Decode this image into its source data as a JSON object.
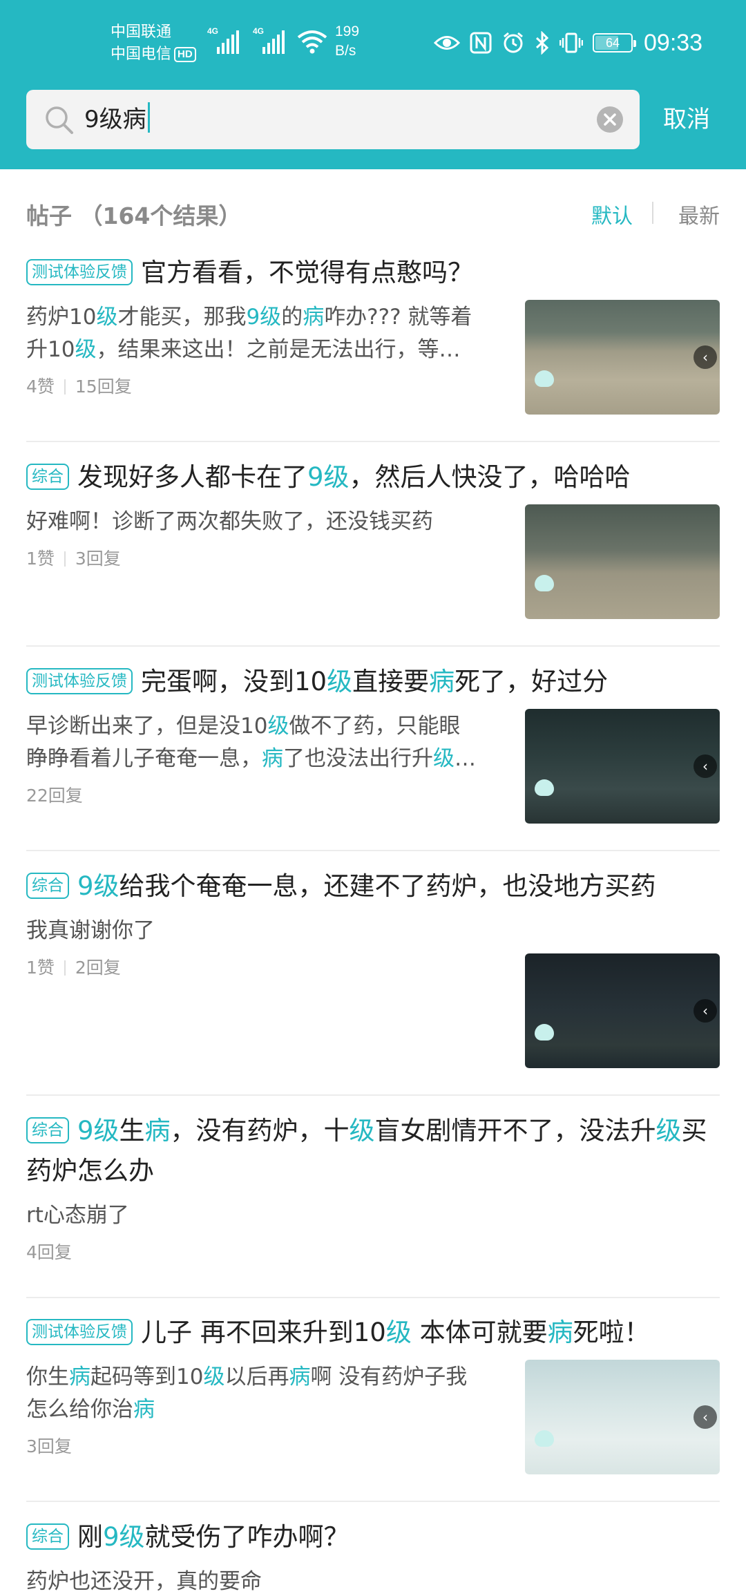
{
  "status_bar": {
    "carrier_1": "中国联通",
    "carrier_2": "中国电信",
    "hd_label": "HD",
    "net_1": "4G",
    "net_2": "4G",
    "speed_value": "199",
    "speed_unit": "B/s",
    "battery_level": "64",
    "time": "09:33"
  },
  "search": {
    "query": "9级病",
    "cancel_label": "取消"
  },
  "results": {
    "title": "帖子 （164个结果）",
    "sort_default": "默认",
    "sort_latest": "最新"
  },
  "posts": [
    {
      "tag": "测试体验反馈",
      "title": [
        {
          "t": "官方看看，不觉得有点憨吗？",
          "h": false
        }
      ],
      "excerpt_lines": [
        [
          {
            "t": "药炉10",
            "h": false
          },
          {
            "t": "级",
            "h": true
          },
          {
            "t": "才能买，那我",
            "h": false
          },
          {
            "t": "9级",
            "h": true
          },
          {
            "t": "的",
            "h": false
          },
          {
            "t": "病",
            "h": true
          },
          {
            "t": "咋办??? 就等着",
            "h": false
          }
        ],
        [
          {
            "t": "升10",
            "h": false
          },
          {
            "t": "级",
            "h": true
          },
          {
            "t": "，结果来这出！之前是无法出行，等…",
            "h": false
          }
        ]
      ],
      "likes": "4赞",
      "replies": "15回复"
    },
    {
      "tag": "综合",
      "title": [
        {
          "t": "发现好多人都卡在了",
          "h": false
        },
        {
          "t": "9级",
          "h": true
        },
        {
          "t": "，然后人快没了，哈哈哈",
          "h": false
        }
      ],
      "excerpt_lines": [
        [
          {
            "t": "好难啊！诊断了两次都失败了，还没钱买药",
            "h": false
          }
        ]
      ],
      "likes": "1赞",
      "replies": "3回复"
    },
    {
      "tag": "测试体验反馈",
      "title": [
        {
          "t": "完蛋啊，没到10",
          "h": false
        },
        {
          "t": "级",
          "h": true
        },
        {
          "t": "直接要",
          "h": false
        },
        {
          "t": "病",
          "h": true
        },
        {
          "t": "死了，好过分",
          "h": false
        }
      ],
      "excerpt_lines": [
        [
          {
            "t": "早诊断出来了，但是没10",
            "h": false
          },
          {
            "t": "级",
            "h": true
          },
          {
            "t": "做不了药，只能眼",
            "h": false
          }
        ],
        [
          {
            "t": "睁睁看着儿子奄奄一息，",
            "h": false
          },
          {
            "t": "病",
            "h": true
          },
          {
            "t": "了也没法出行升",
            "h": false
          },
          {
            "t": "级",
            "h": true
          },
          {
            "t": "…",
            "h": false
          }
        ]
      ],
      "likes": "",
      "replies": "22回复"
    },
    {
      "tag": "综合",
      "title": [
        {
          "t": "9级",
          "h": true
        },
        {
          "t": "给我个奄奄一息，还建不了药炉，也没地方买药",
          "h": false
        }
      ],
      "excerpt_lines": [
        [
          {
            "t": "我真谢谢你了",
            "h": false
          }
        ]
      ],
      "likes": "1赞",
      "replies": "2回复"
    },
    {
      "tag": "综合",
      "title": [
        {
          "t": "9级",
          "h": true
        },
        {
          "t": "生",
          "h": false
        },
        {
          "t": "病",
          "h": true
        },
        {
          "t": "，没有药炉，十",
          "h": false
        },
        {
          "t": "级",
          "h": true
        },
        {
          "t": "盲女剧情开不了，没法升",
          "h": false
        },
        {
          "t": "级",
          "h": true
        },
        {
          "t": "买药炉怎么办",
          "h": false
        }
      ],
      "excerpt_lines": [
        [
          {
            "t": "rt心态崩了",
            "h": false
          }
        ]
      ],
      "likes": "",
      "replies": "4回复"
    },
    {
      "tag": "测试体验反馈",
      "title": [
        {
          "t": "儿子 再不回来升到10",
          "h": false
        },
        {
          "t": "级",
          "h": true
        },
        {
          "t": " 本体可就要",
          "h": false
        },
        {
          "t": "病",
          "h": true
        },
        {
          "t": "死啦！",
          "h": false
        }
      ],
      "excerpt_lines": [
        [
          {
            "t": "你生",
            "h": false
          },
          {
            "t": "病",
            "h": true
          },
          {
            "t": "起码等到10",
            "h": false
          },
          {
            "t": "级",
            "h": true
          },
          {
            "t": "以后再",
            "h": false
          },
          {
            "t": "病",
            "h": true
          },
          {
            "t": "啊 没有药炉子我",
            "h": false
          }
        ],
        [
          {
            "t": "怎么给你治",
            "h": false
          },
          {
            "t": "病",
            "h": true
          }
        ]
      ],
      "likes": "",
      "replies": "3回复"
    },
    {
      "tag": "综合",
      "title": [
        {
          "t": "刚",
          "h": false
        },
        {
          "t": "9级",
          "h": true
        },
        {
          "t": "就受伤了咋办啊？",
          "h": false
        }
      ],
      "excerpt_lines": [
        [
          {
            "t": "药炉也还没开，真的要命",
            "h": false
          }
        ]
      ],
      "likes": "",
      "replies": ""
    }
  ],
  "colors": {
    "accent": "#25b8c2",
    "title_text": "#222222",
    "meta_text": "#999999"
  }
}
